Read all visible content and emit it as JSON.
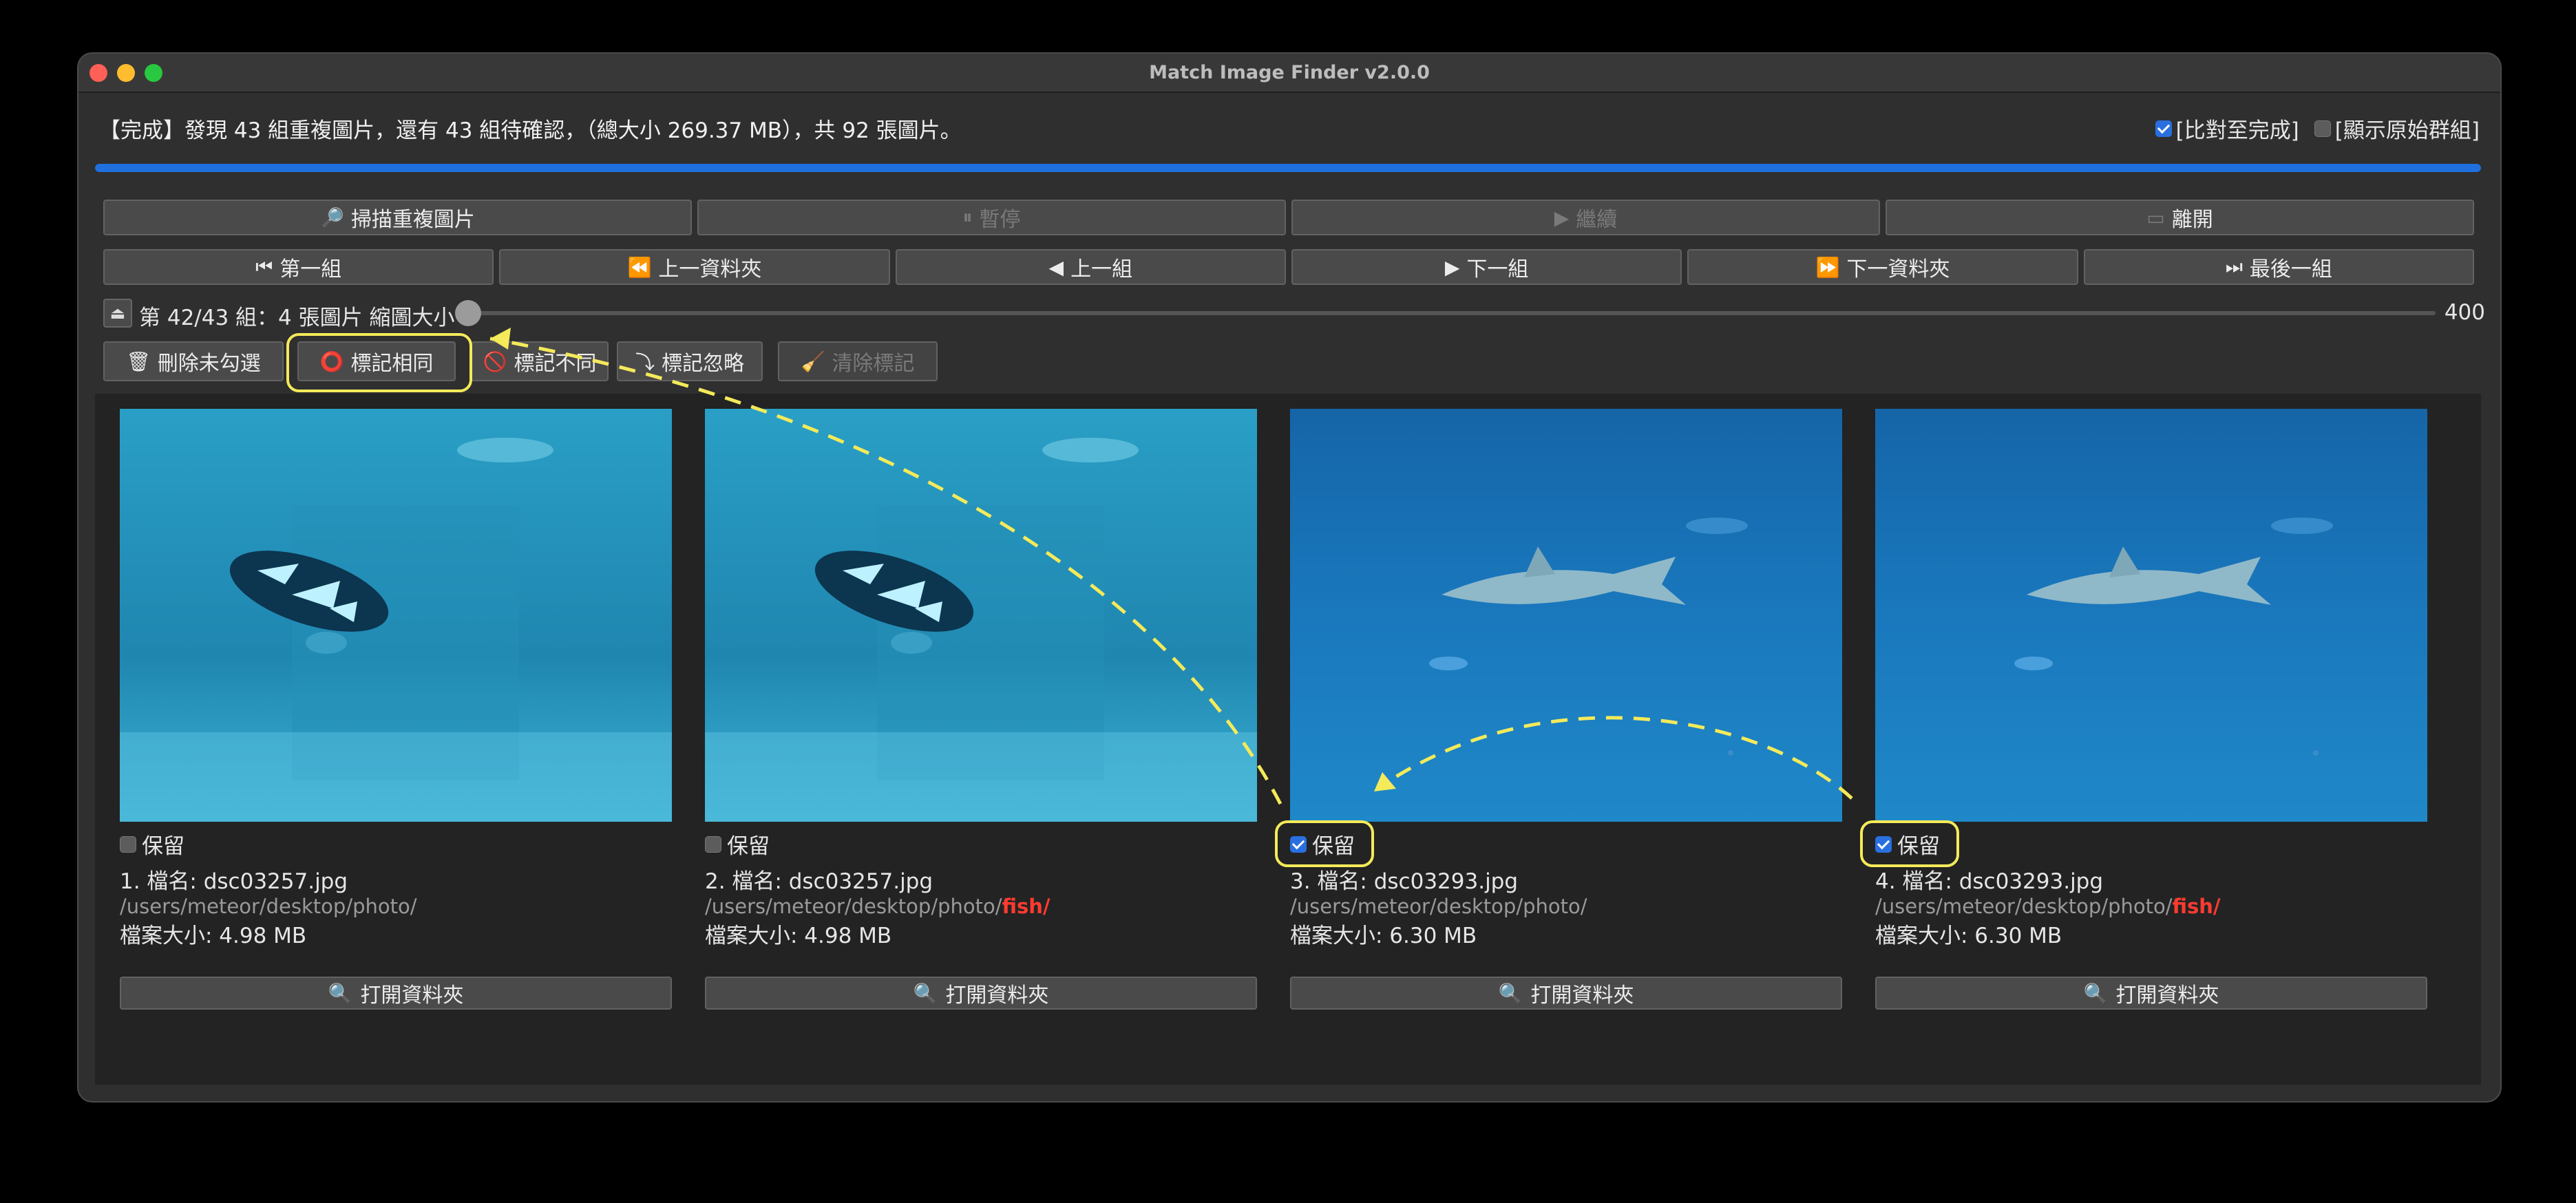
{
  "window": {
    "title": "Match Image Finder v2.0.0"
  },
  "status": {
    "text": "【完成】發現 43 組重複圖片，還有 43 組待確認，（總大小 269.37 MB），共 92 張圖片。"
  },
  "options": [
    {
      "label": "[比對至完成]",
      "checked": true
    },
    {
      "label": "[顯示原始群組]",
      "checked": false
    }
  ],
  "progress": {
    "value": 1.0,
    "color": "#1f6fdc"
  },
  "controls": {
    "scan": "掃描重複圖片",
    "pause": "暫停",
    "resume": "繼續",
    "exit": "離開"
  },
  "nav": {
    "first": "第一組",
    "prev_folder": "上一資料夾",
    "prev": "上一組",
    "next": "下一組",
    "next_folder": "下一資料夾",
    "last": "最後一組"
  },
  "group": {
    "label": "第 42/43 組：4 張圖片 縮圖大小",
    "slider_max": "400",
    "slider_value_fraction": 0.0
  },
  "marks": {
    "delete_unchecked": "刪除未勾選",
    "mark_same": "標記相同",
    "mark_diff": "標記不同",
    "mark_ignore": "標記忽略",
    "clear_marks": "清除標記"
  },
  "cards": [
    {
      "keep_label": "保留",
      "keep": false,
      "name": "1. 檔名: dsc03257.jpg",
      "path": "/users/meteor/desktop/photo/",
      "sub": "",
      "size": "檔案大小: 4.98 MB",
      "open": "打開資料夾",
      "subject": "clownfish"
    },
    {
      "keep_label": "保留",
      "keep": false,
      "name": "2. 檔名: dsc03257.jpg",
      "path": "/users/meteor/desktop/photo/",
      "sub": "fish/",
      "size": "檔案大小: 4.98 MB",
      "open": "打開資料夾",
      "subject": "clownfish"
    },
    {
      "keep_label": "保留",
      "keep": true,
      "name": "3. 檔名: dsc03293.jpg",
      "path": "/users/meteor/desktop/photo/",
      "sub": "",
      "size": "檔案大小: 6.30 MB",
      "open": "打開資料夾",
      "subject": "shark"
    },
    {
      "keep_label": "保留",
      "keep": true,
      "name": "4. 檔名: dsc03293.jpg",
      "path": "/users/meteor/desktop/photo/",
      "sub": "fish/",
      "size": "檔案大小: 6.30 MB",
      "open": "打開資料夾",
      "subject": "shark"
    }
  ],
  "colors": {
    "highlight": "#f4ea5a",
    "accent": "#2a6fe0",
    "folder_highlight": "#ff3b30"
  }
}
